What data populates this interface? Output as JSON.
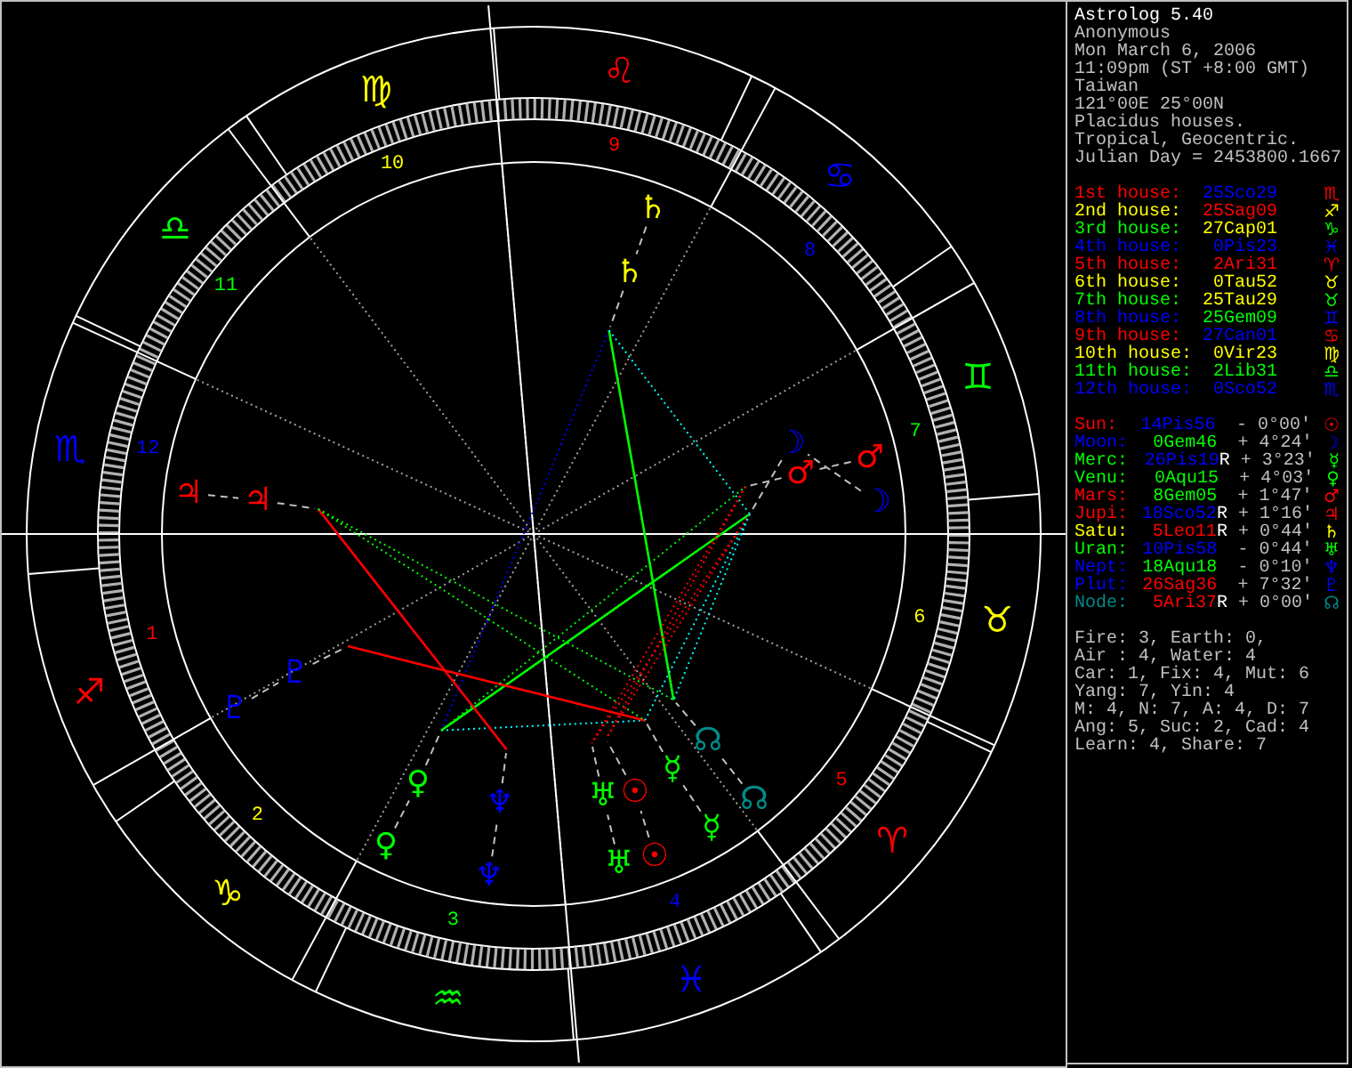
{
  "chart": {
    "signs": [
      {
        "glyph": "♌",
        "color": "#ff0000"
      },
      {
        "glyph": "♋",
        "color": "#0000ff"
      },
      {
        "glyph": "♊",
        "color": "#00ff00"
      },
      {
        "glyph": "♉",
        "color": "#ffff00"
      },
      {
        "glyph": "♈",
        "color": "#ff0000"
      },
      {
        "glyph": "♓",
        "color": "#0000ff"
      },
      {
        "glyph": "♒",
        "color": "#00ff00"
      },
      {
        "glyph": "♑",
        "color": "#ffff00"
      },
      {
        "glyph": "♐",
        "color": "#ff0000"
      },
      {
        "glyph": "♏",
        "color": "#0000ff"
      },
      {
        "glyph": "♎",
        "color": "#00ff00"
      },
      {
        "glyph": "♍",
        "color": "#ffff00"
      }
    ],
    "house_numbers": [
      {
        "label": "9",
        "color": "#ff0000"
      },
      {
        "label": "8",
        "color": "#0000ff"
      },
      {
        "label": "7",
        "color": "#00ff00"
      },
      {
        "label": "6",
        "color": "#ffff00"
      },
      {
        "label": "5",
        "color": "#ff0000"
      },
      {
        "label": "4",
        "color": "#0000ff"
      },
      {
        "label": "3",
        "color": "#00ff00"
      },
      {
        "label": "2",
        "color": "#ffff00"
      },
      {
        "label": "1",
        "color": "#ff0000"
      },
      {
        "label": "12",
        "color": "#0000ff"
      },
      {
        "label": "11",
        "color": "#00ff00"
      },
      {
        "label": "10",
        "color": "#ffff00"
      }
    ],
    "planet_glyphs": [
      {
        "glyph": "☉",
        "color": "#ff0000"
      },
      {
        "glyph": "☉",
        "color": "#ff0000"
      },
      {
        "glyph": "☽",
        "color": "#0000ff"
      },
      {
        "glyph": "☽",
        "color": "#0000ff"
      },
      {
        "glyph": "☿",
        "color": "#00ff00"
      },
      {
        "glyph": "☿",
        "color": "#00ff00"
      },
      {
        "glyph": "♀",
        "color": "#00ff00"
      },
      {
        "glyph": "♀",
        "color": "#00ff00"
      },
      {
        "glyph": "♂",
        "color": "#ff0000"
      },
      {
        "glyph": "♂",
        "color": "#ff0000"
      },
      {
        "glyph": "♃",
        "color": "#ff0000"
      },
      {
        "glyph": "♃",
        "color": "#ff0000"
      },
      {
        "glyph": "♄",
        "color": "#ffff00"
      },
      {
        "glyph": "♄",
        "color": "#ffff00"
      },
      {
        "glyph": "♅",
        "color": "#00ff00"
      },
      {
        "glyph": "♅",
        "color": "#00ff00"
      },
      {
        "glyph": "♆",
        "color": "#0000ff"
      },
      {
        "glyph": "♆",
        "color": "#0000ff"
      },
      {
        "glyph": "♇",
        "color": "#0000ff"
      },
      {
        "glyph": "♇",
        "color": "#0000ff"
      },
      {
        "glyph": "☊",
        "color": "#008b8b"
      },
      {
        "glyph": "☊",
        "color": "#008b8b"
      }
    ]
  },
  "info": {
    "header": [
      "Astrolog 5.40",
      "Anonymous",
      "Mon March 6, 2006",
      "11:09pm (ST +8:00 GMT)",
      "Taiwan",
      "121°00E 25°00N",
      "Placidus houses.",
      "Tropical, Geocentric.",
      "Julian Day = 2453800.1667"
    ],
    "houses": [
      {
        "label": "1st house:",
        "position": {
          "text": "25Sco29",
          "color": "#0000ff"
        },
        "glyph": "♏",
        "color": "#ff0000"
      },
      {
        "label": "2nd house:",
        "position": {
          "text": "25Sag09",
          "color": "#ff0000"
        },
        "glyph": "♐",
        "color": "#ffff00"
      },
      {
        "label": "3rd house:",
        "position": {
          "text": "27Cap01",
          "color": "#ffff00"
        },
        "glyph": "♑",
        "color": "#00ff00"
      },
      {
        "label": "4th house:",
        "position": {
          "text": "0Pis23",
          "color": "#0000ff"
        },
        "glyph": "♓",
        "color": "#0000ff"
      },
      {
        "label": "5th house:",
        "position": {
          "text": "2Ari31",
          "color": "#ff0000"
        },
        "glyph": "♈",
        "color": "#ff0000"
      },
      {
        "label": "6th house:",
        "position": {
          "text": "0Tau52",
          "color": "#ffff00"
        },
        "glyph": "♉",
        "color": "#ffff00"
      },
      {
        "label": "7th house:",
        "position": {
          "text": "25Tau29",
          "color": "#ffff00"
        },
        "glyph": "♉",
        "color": "#00ff00"
      },
      {
        "label": "8th house:",
        "position": {
          "text": "25Gem09",
          "color": "#00ff00"
        },
        "glyph": "♊",
        "color": "#0000ff"
      },
      {
        "label": "9th house:",
        "position": {
          "text": "27Can01",
          "color": "#0000ff"
        },
        "glyph": "♋",
        "color": "#ff0000"
      },
      {
        "label": "10th house:",
        "position": {
          "text": "0Vir23",
          "color": "#ffff00"
        },
        "glyph": "♍",
        "color": "#ffff00"
      },
      {
        "label": "11th house:",
        "position": {
          "text": "2Lib31",
          "color": "#00ff00"
        },
        "glyph": "♎",
        "color": "#00ff00"
      },
      {
        "label": "12th house:",
        "position": {
          "text": "0Sco52",
          "color": "#0000ff"
        },
        "glyph": "♏",
        "color": "#0000ff"
      }
    ],
    "planets": [
      {
        "name": "Sun:",
        "position": {
          "text": "14Pis56",
          "color": "#0000ff"
        },
        "motion": "- 0°00'",
        "glyph": "☉",
        "color": "#ff0000"
      },
      {
        "name": "Moon:",
        "position": {
          "text": "0Gem46",
          "color": "#00ff00"
        },
        "motion": "+ 4°24'",
        "glyph": "☽",
        "color": "#0000ff"
      },
      {
        "name": "Merc:",
        "position": {
          "text": "26Pis19",
          "color": "#0000ff"
        },
        "retrograde": "R",
        "motion": "+ 3°23'",
        "glyph": "☿",
        "color": "#00ff00"
      },
      {
        "name": "Venu:",
        "position": {
          "text": "0Aqu15",
          "color": "#00ff00"
        },
        "motion": "+ 4°03'",
        "glyph": "♀",
        "color": "#00ff00"
      },
      {
        "name": "Mars:",
        "position": {
          "text": "8Gem05",
          "color": "#00ff00"
        },
        "motion": "+ 1°47'",
        "glyph": "♂",
        "color": "#ff0000"
      },
      {
        "name": "Jupi:",
        "position": {
          "text": "18Sco52",
          "color": "#0000ff"
        },
        "retrograde": "R",
        "motion": "+ 1°16'",
        "glyph": "♃",
        "color": "#ff0000"
      },
      {
        "name": "Satu:",
        "position": {
          "text": "5Leo11",
          "color": "#ff0000"
        },
        "retrograde": "R",
        "motion": "+ 0°44'",
        "glyph": "♄",
        "color": "#ffff00"
      },
      {
        "name": "Uran:",
        "position": {
          "text": "10Pis58",
          "color": "#0000ff"
        },
        "motion": "- 0°44'",
        "glyph": "♅",
        "color": "#00ff00"
      },
      {
        "name": "Nept:",
        "position": {
          "text": "18Aqu18",
          "color": "#00ff00"
        },
        "motion": "- 0°10'",
        "glyph": "♆",
        "color": "#0000ff"
      },
      {
        "name": "Plut:",
        "position": {
          "text": "26Sag36",
          "color": "#ff0000"
        },
        "motion": "+ 7°32'",
        "glyph": "♇",
        "color": "#0000ff"
      },
      {
        "name": "Node:",
        "position": {
          "text": "5Ari37",
          "color": "#ff0000"
        },
        "retrograde": "R",
        "motion": "+ 0°00'",
        "glyph": "☊",
        "color": "#008b8b"
      }
    ],
    "stats": [
      "Fire: 3, Earth: 0,",
      "Air : 4, Water: 4",
      "Car: 1, Fix: 4, Mut: 6",
      "Yang: 7, Yin: 4",
      "M: 4, N: 7, A: 4, D: 7",
      "Ang: 5, Suc: 2, Cad: 4",
      "Learn: 4, Share: 7"
    ]
  }
}
